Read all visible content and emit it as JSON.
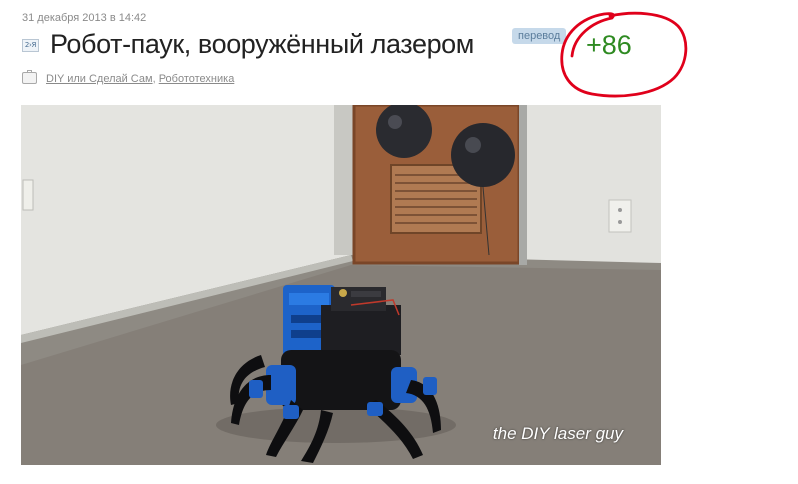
{
  "post": {
    "date": "31 декабря 2013 в 14:42",
    "title": "Робот-паук, вооружённый лазером",
    "badge": "перевод",
    "score": "+86",
    "type_icon": "translation-icon",
    "hubs_icon": "briefcase-icon",
    "hubs": [
      {
        "label": "DIY или Сделай Сам"
      },
      {
        "label": "Робототехника"
      }
    ],
    "hubs_separator": ", "
  },
  "photo": {
    "caption": "the DIY laser guy"
  },
  "colors": {
    "score": "#2e8a21",
    "annotation_circle": "#e0001b",
    "badge_bg": "#c6d9ea",
    "link": "#8a8a8a"
  }
}
